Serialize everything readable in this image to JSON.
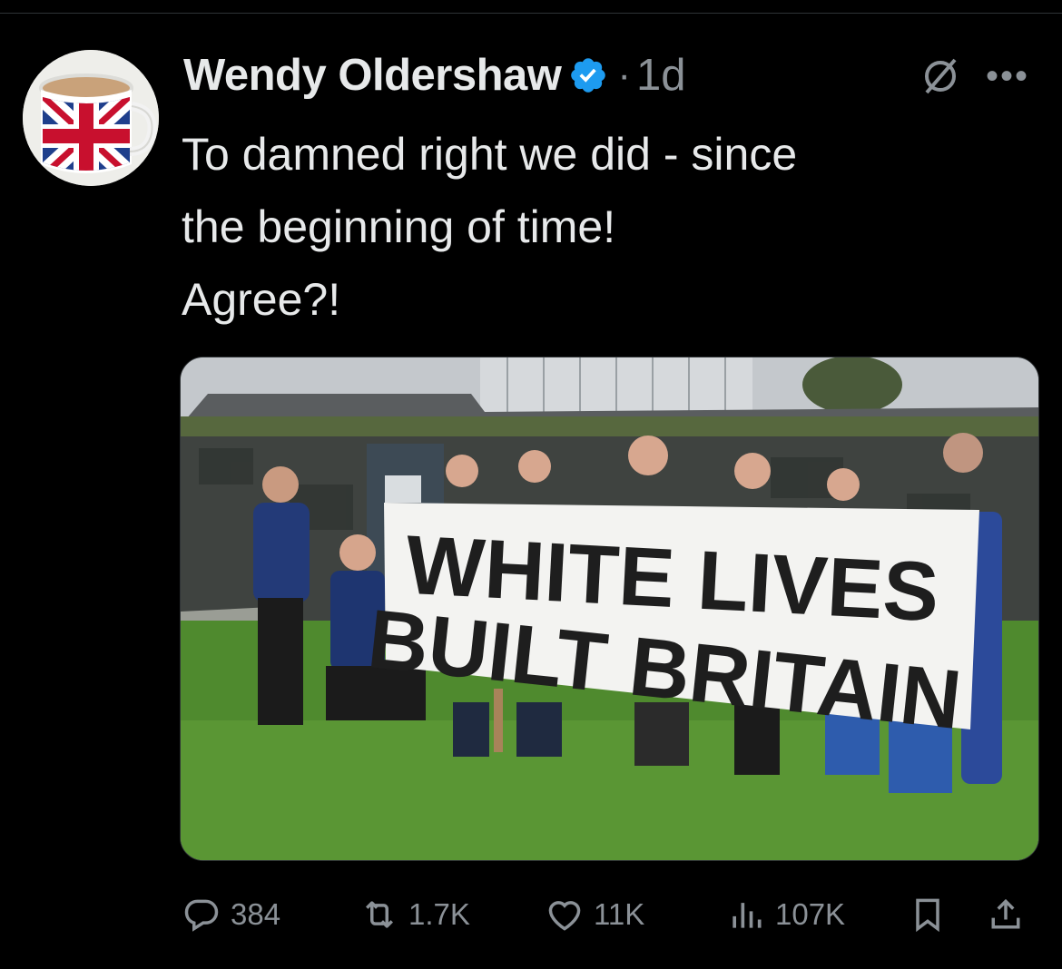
{
  "tweet": {
    "author_name": "Wendy Oldershaw",
    "separator": "·",
    "timestamp": "1d",
    "text_lines": [
      "To damned right we did - since",
      "the beginning of time!",
      "Agree?!"
    ],
    "image": {
      "banner_line_1": "WHITE LIVES",
      "banner_line_2": "BUILT BRITAIN"
    },
    "stats": {
      "replies": "384",
      "reposts": "1.7K",
      "likes": "11K",
      "views": "107K"
    }
  },
  "icons": {
    "avatar": "union-jack-mug",
    "verified": "verified-badge-icon",
    "grok": "grok-icon",
    "more": "more-icon",
    "reply": "reply-icon",
    "repost": "repost-icon",
    "like": "heart-icon",
    "views": "views-icon",
    "bookmark": "bookmark-icon",
    "share": "share-icon"
  },
  "colors": {
    "background": "#000000",
    "text": "#e7e9ea",
    "secondary": "#8b9197",
    "verified": "#1d9bf0"
  }
}
